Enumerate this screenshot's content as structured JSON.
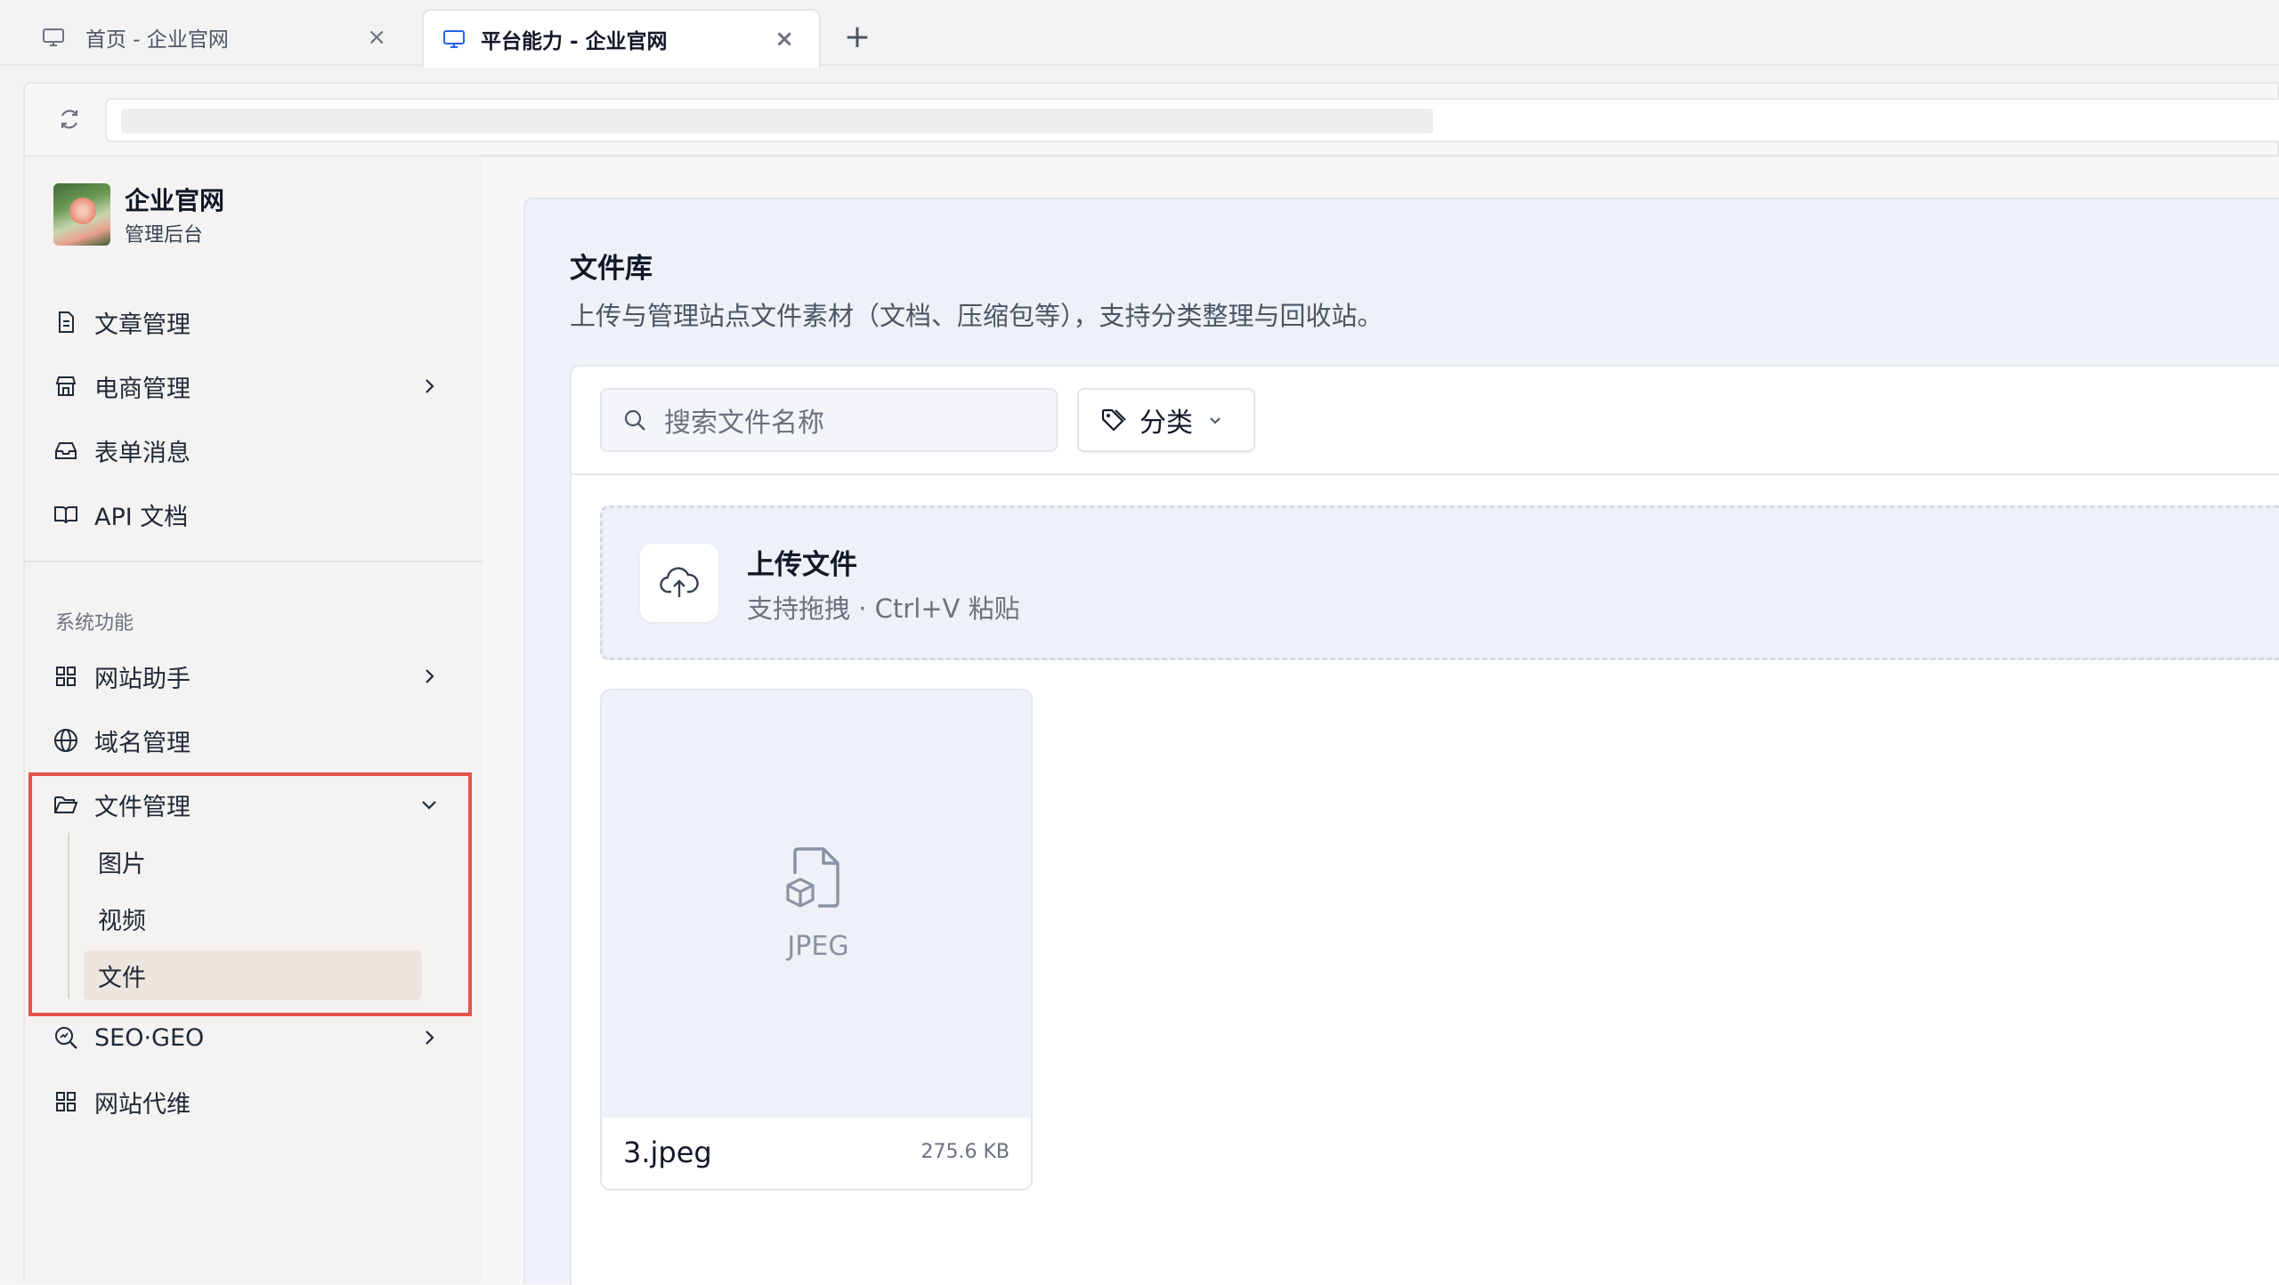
{
  "browser": {
    "tabs": [
      {
        "title": "首页 - 企业官网",
        "icon": "monitor-icon",
        "active": false
      },
      {
        "title": "平台能力 - 企业官网",
        "icon": "monitor-icon",
        "active": true
      }
    ],
    "new_tab": "+",
    "close_glyph": "×"
  },
  "brand": {
    "name": "企业官网",
    "subtitle": "管理后台"
  },
  "nav": {
    "items": [
      {
        "label": "文章管理",
        "icon": "document-icon"
      },
      {
        "label": "电商管理",
        "icon": "store-icon",
        "chevron": "right"
      },
      {
        "label": "表单消息",
        "icon": "inbox-icon"
      },
      {
        "label": "API 文档",
        "icon": "book-icon"
      }
    ],
    "section_title": "系统功能",
    "system_items": [
      {
        "label": "网站助手",
        "icon": "grid-icon",
        "chevron": "right"
      },
      {
        "label": "域名管理",
        "icon": "globe-icon"
      },
      {
        "label": "文件管理",
        "icon": "folder-open-icon",
        "chevron": "down"
      },
      {
        "label": "SEO·GEO",
        "icon": "search-analytics-icon",
        "chevron": "right"
      },
      {
        "label": "网站代维",
        "icon": "grid-icon"
      }
    ],
    "file_sub_items": [
      {
        "label": "图片",
        "active": false
      },
      {
        "label": "视频",
        "active": false
      },
      {
        "label": "文件",
        "active": true
      }
    ]
  },
  "main": {
    "title": "文件库",
    "description": "上传与管理站点文件素材（文档、压缩包等），支持分类整理与回收站。",
    "search_placeholder": "搜索文件名称",
    "category_label": "分类",
    "upload": {
      "title": "上传文件",
      "subtitle": "支持拖拽 · Ctrl+V 粘贴"
    },
    "files": [
      {
        "type": "JPEG",
        "name": "3.jpeg",
        "size": "275.6 KB"
      }
    ]
  },
  "colors": {
    "highlight": "#e5534b",
    "active_sub_bg": "#ede5df",
    "main_bg": "#eef1f8",
    "accent_tab_icon": "#2563eb"
  }
}
